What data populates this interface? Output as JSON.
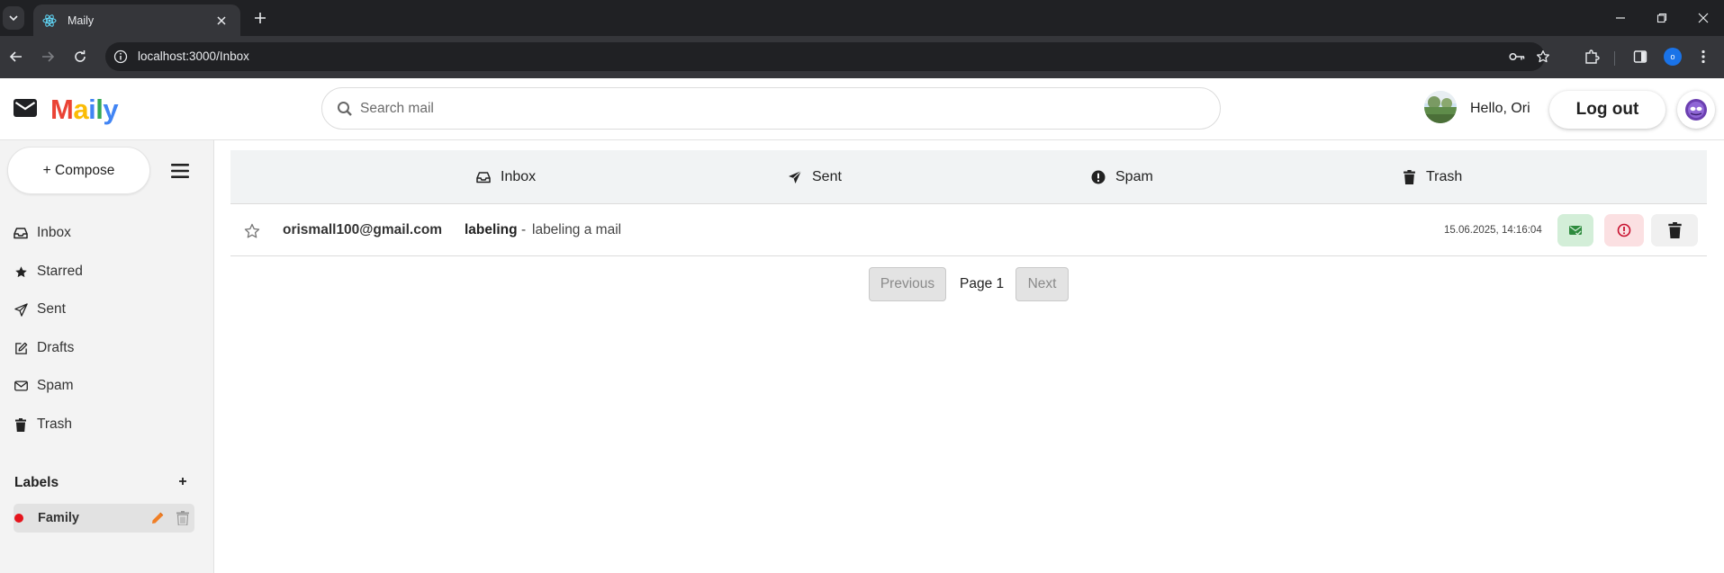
{
  "browser": {
    "tab_title": "Maily",
    "url": "localhost:3000/Inbox",
    "profile_initial": "o"
  },
  "app": {
    "logo_letters": [
      {
        "char": "M",
        "color": "#ea4335"
      },
      {
        "char": "a",
        "color": "#fbbc05"
      },
      {
        "char": "i",
        "color": "#4285f4"
      },
      {
        "char": "l",
        "color": "#34a853"
      },
      {
        "char": "y",
        "color": "#4285f4"
      }
    ],
    "search_placeholder": "Search mail",
    "greeting": "Hello, Ori",
    "logout_label": "Log out"
  },
  "sidebar": {
    "compose_label": "+ Compose",
    "items": [
      {
        "label": "Inbox",
        "icon": "inbox-icon"
      },
      {
        "label": "Starred",
        "icon": "star-icon"
      },
      {
        "label": "Sent",
        "icon": "send-icon"
      },
      {
        "label": "Drafts",
        "icon": "edit-icon"
      },
      {
        "label": "Spam",
        "icon": "envelope-icon"
      },
      {
        "label": "Trash",
        "icon": "trash-icon"
      }
    ],
    "labels_title": "Labels",
    "labels": [
      {
        "name": "Family",
        "color": "#e5141c"
      }
    ]
  },
  "folder_tabs": [
    {
      "label": "Inbox",
      "icon": "inbox-icon"
    },
    {
      "label": "Sent",
      "icon": "send-icon"
    },
    {
      "label": "Spam",
      "icon": "exclamation-icon"
    },
    {
      "label": "Trash",
      "icon": "trash-icon"
    }
  ],
  "mails": [
    {
      "sender": "orismall100@gmail.com",
      "subject": "labeling",
      "separator": "-",
      "snippet": "labeling a mail",
      "date": "15.06.2025, 14:16:04",
      "starred": false
    }
  ],
  "pagination": {
    "previous_label": "Previous",
    "page_label": "Page 1",
    "next_label": "Next"
  }
}
